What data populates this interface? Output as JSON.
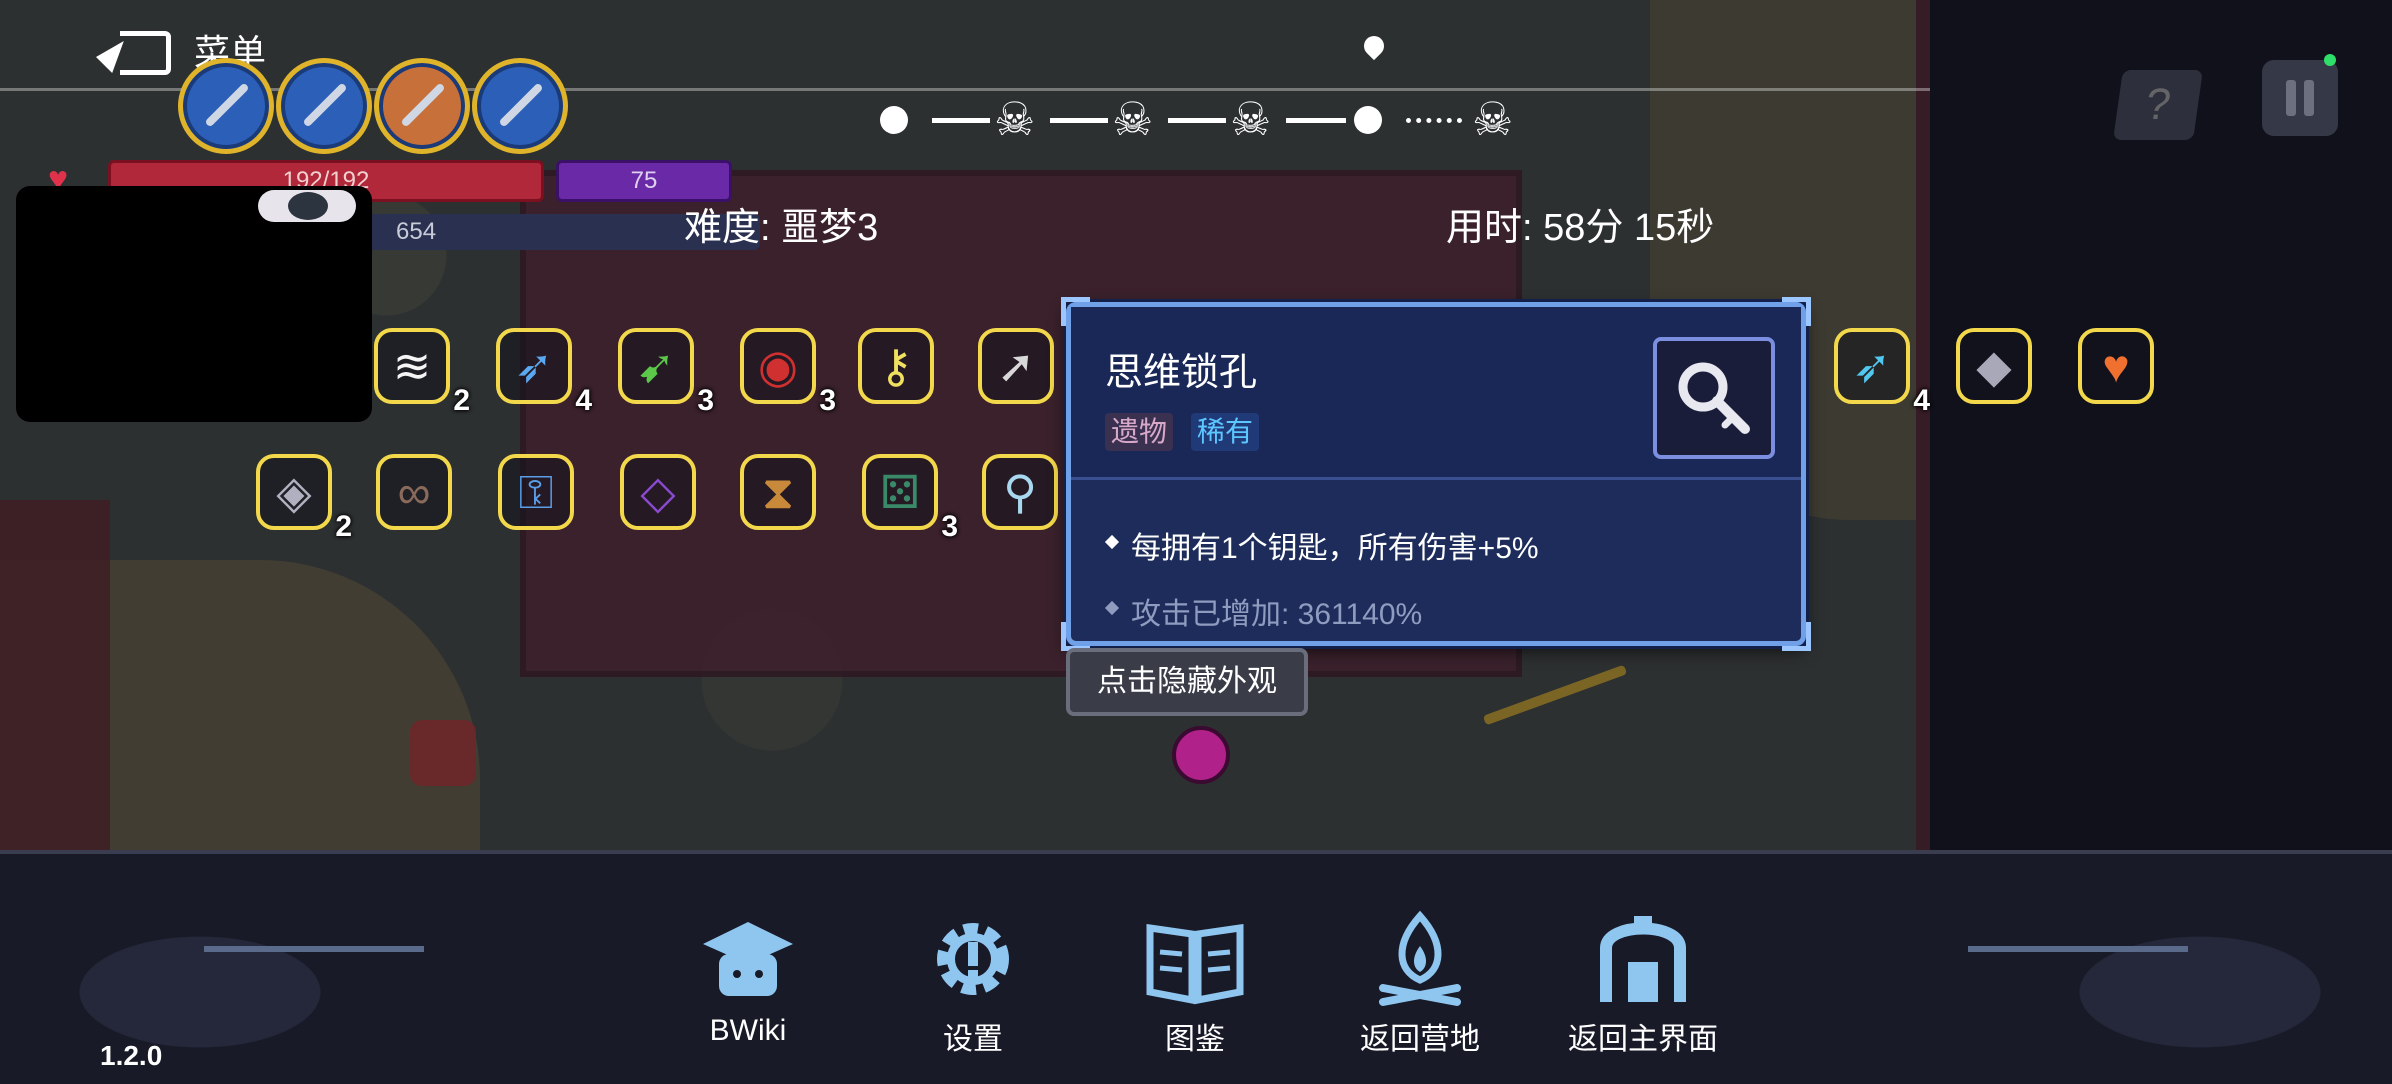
{
  "top_bar": {
    "menu_label": "菜单",
    "hp_text": "192/192",
    "mp_text": "75",
    "shield_text": "654"
  },
  "stage": {
    "difficulty": "难度: 噩梦3",
    "time_used": "用时: 58分 15秒"
  },
  "relics_row1": [
    {
      "name": "fang-jaw",
      "count": "2",
      "color": "#f5f5f5",
      "glyph": "≋"
    },
    {
      "name": "blue-crossbow",
      "count": "4",
      "color": "#5aa8f0",
      "glyph": "➶"
    },
    {
      "name": "green-arrow",
      "count": "3",
      "color": "#5cc84a",
      "glyph": "➹"
    },
    {
      "name": "red-eye-horn",
      "count": "3",
      "color": "#d03030",
      "glyph": "◉"
    },
    {
      "name": "thought-keyhole",
      "count": "",
      "color": "#f0e060",
      "glyph": "⚷"
    },
    {
      "name": "plus-arrow",
      "count": "",
      "color": "#d8d8d8",
      "glyph": "➚"
    }
  ],
  "relics_row1_right": [
    {
      "name": "ice-crossbow",
      "count": "4",
      "color": "#50c8f0",
      "glyph": "➶"
    },
    {
      "name": "crystal-shard",
      "count": "",
      "color": "#a8a8b8",
      "glyph": "◆"
    },
    {
      "name": "heart",
      "count": "",
      "color": "#f07030",
      "glyph": "♥"
    }
  ],
  "relics_row2": [
    {
      "name": "stone-fragment",
      "count": "2",
      "color": "#b0b0c0",
      "glyph": "◈"
    },
    {
      "name": "chain",
      "count": "",
      "color": "#8a6a5a",
      "glyph": "∞"
    },
    {
      "name": "blue-key",
      "count": "",
      "color": "#5a9ee8",
      "glyph": "⚿"
    },
    {
      "name": "purple-gem-box",
      "count": "",
      "color": "#8a4ad0",
      "glyph": "◇"
    },
    {
      "name": "hourglass",
      "count": "",
      "color": "#c88a3a",
      "glyph": "⧗"
    },
    {
      "name": "dice",
      "count": "3",
      "color": "#3a8a6a",
      "glyph": "⚄"
    },
    {
      "name": "magnifier",
      "count": "",
      "color": "#a8d8f0",
      "glyph": "⚲"
    }
  ],
  "tooltip": {
    "title": "思维锁孔",
    "tag_type": "遗物",
    "tag_rarity": "稀有",
    "effect": "每拥有1个钥匙，所有伤害+5%",
    "bonus": "攻击已增加: 361140%"
  },
  "hide_button": "点击隐藏外观",
  "bottom_nav": [
    {
      "label": "BWiki",
      "icon": "graduation-cap-icon"
    },
    {
      "label": "设置",
      "icon": "gear-icon"
    },
    {
      "label": "图鉴",
      "icon": "book-icon"
    },
    {
      "label": "返回营地",
      "icon": "campfire-icon"
    },
    {
      "label": "返回主界面",
      "icon": "arch-gate-icon"
    }
  ],
  "version": "1.2.0",
  "colors": {
    "tooltip_bg": "#1d2c5a",
    "tooltip_border": "#6fa0e8",
    "rarity_blue": "#5cc6ff",
    "relic_frame": "#f2d84a"
  }
}
